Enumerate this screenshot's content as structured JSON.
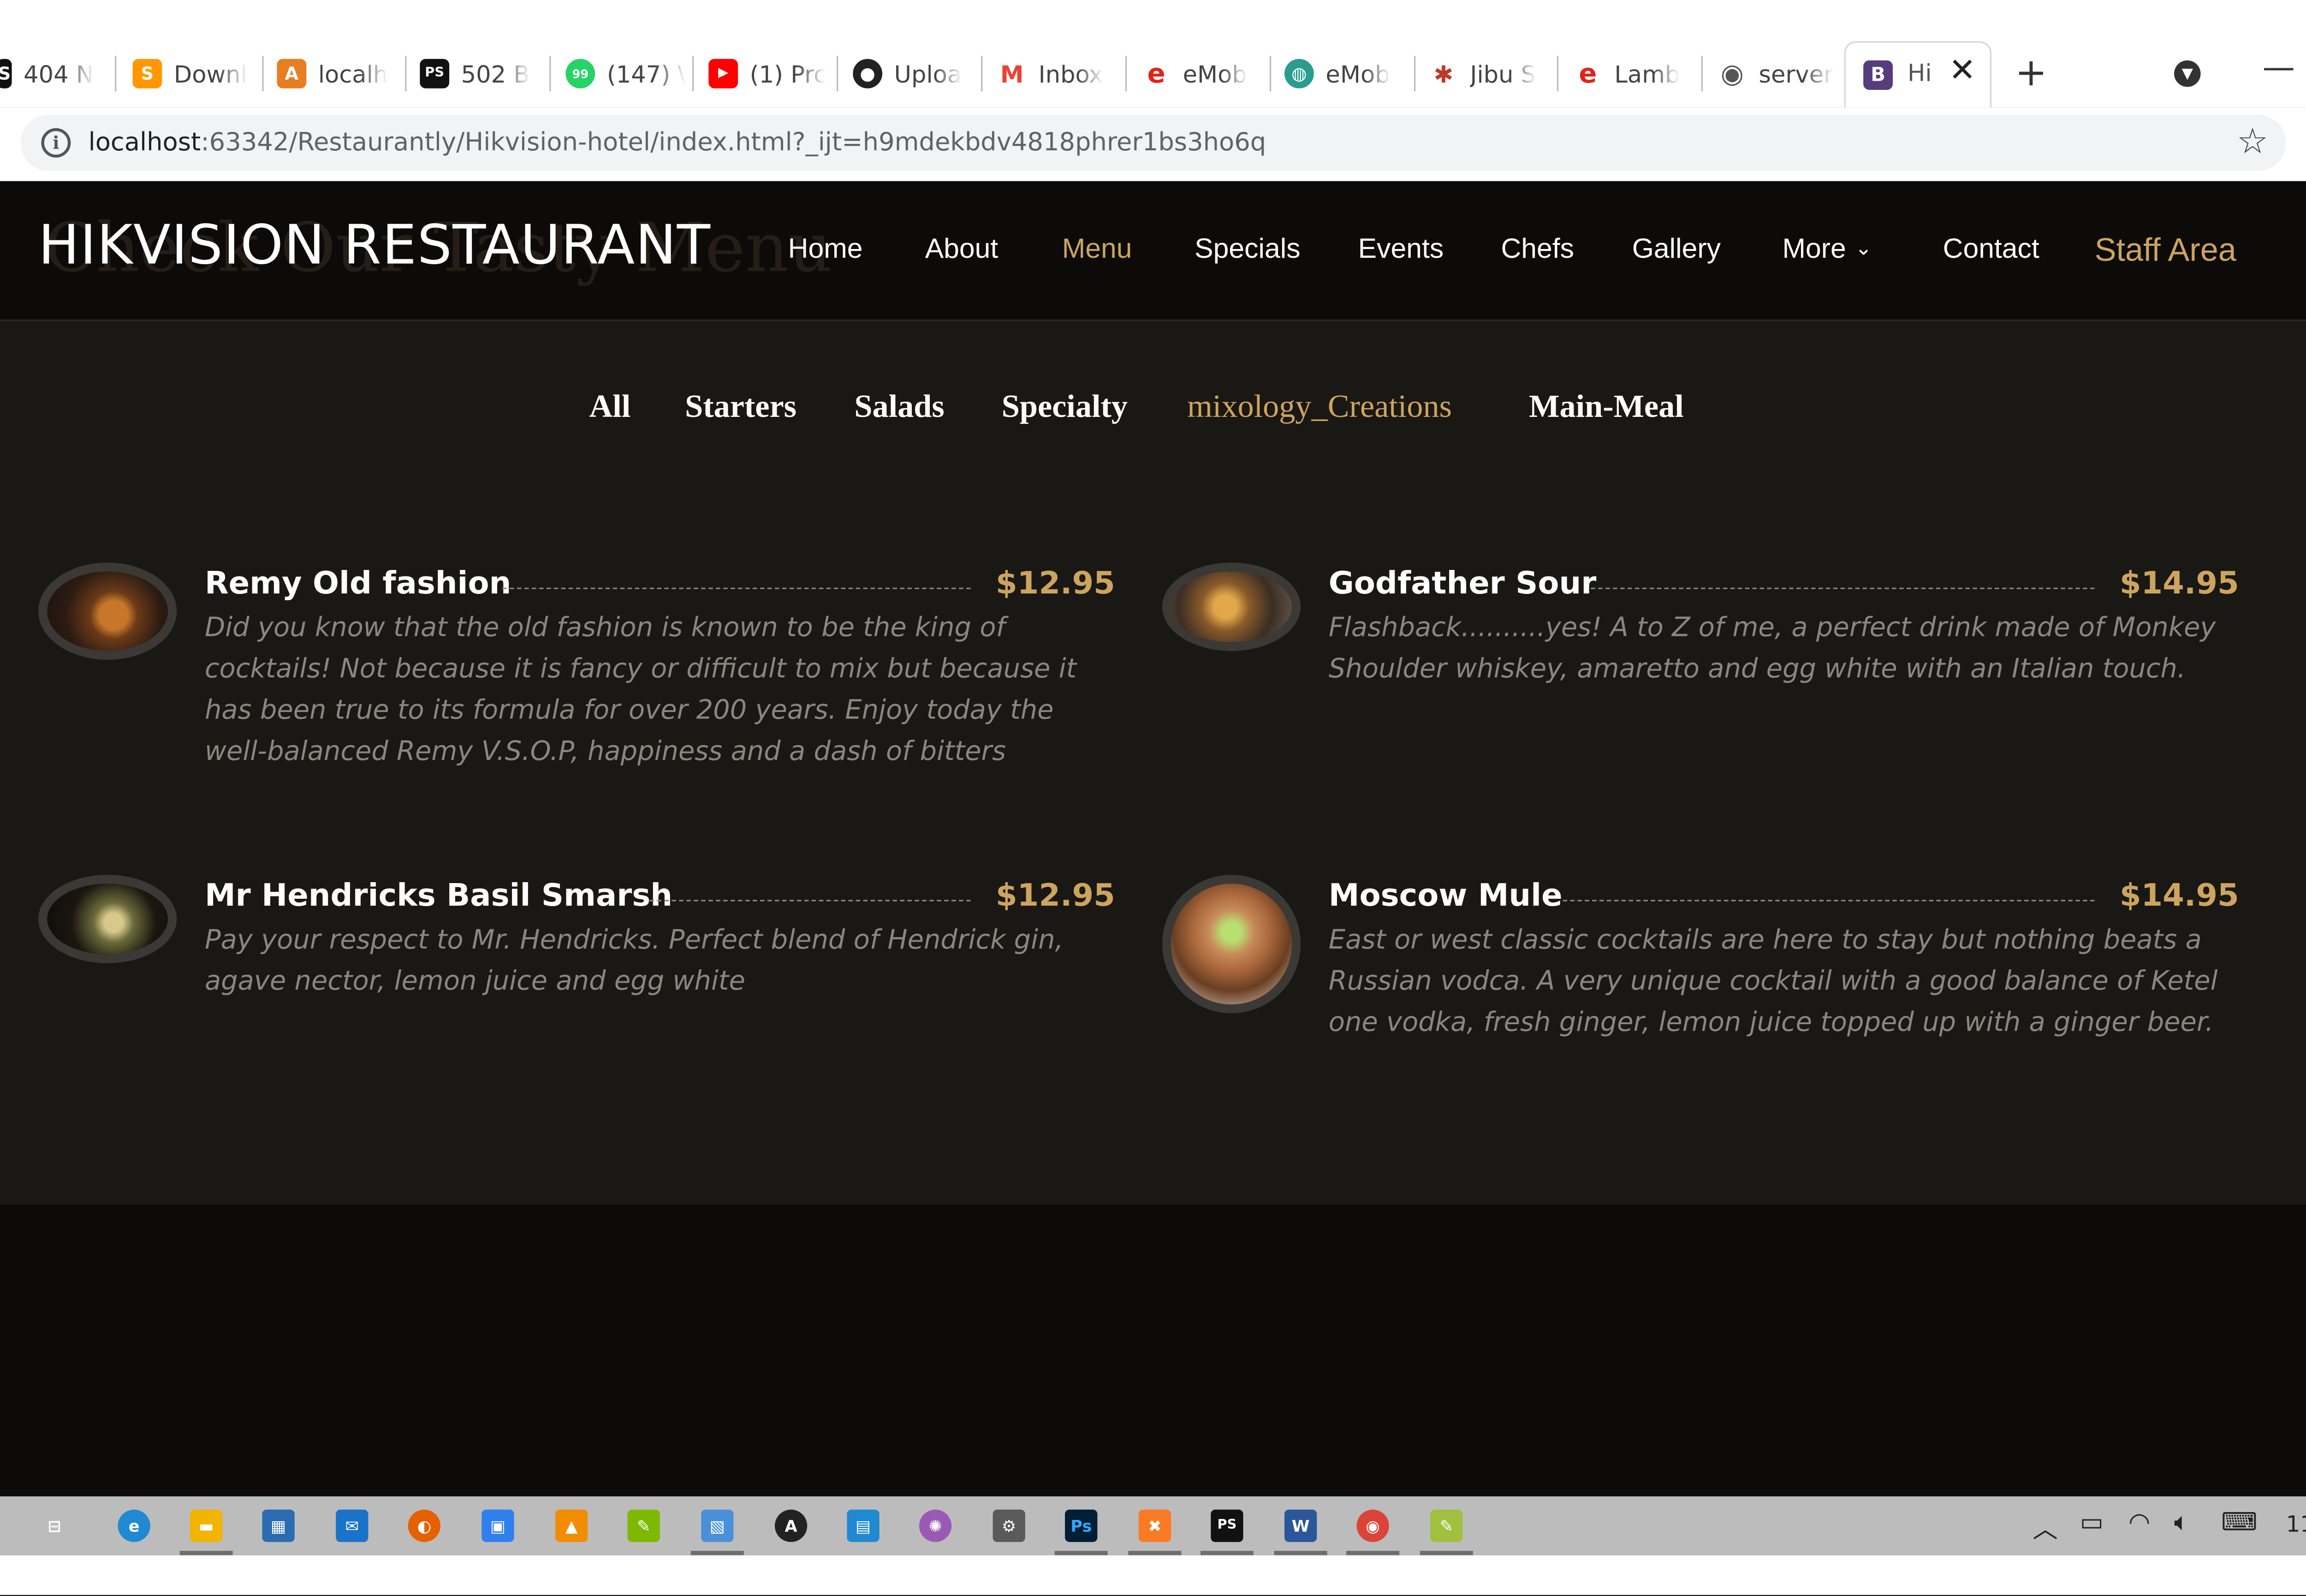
{
  "browser": {
    "tabs": [
      {
        "label": "404 N",
        "icon": "server-favicon-icon",
        "color": "#111111",
        "glyph": "S"
      },
      {
        "label": "Downl",
        "icon": "sublime-favicon-icon",
        "color": "#ff9800",
        "glyph": "S"
      },
      {
        "label": "localh",
        "icon": "phpmyadmin-favicon-icon",
        "color": "#e67e22",
        "glyph": "A"
      },
      {
        "label": "502 B",
        "icon": "phpstorm-favicon-icon",
        "color": "#111111",
        "glyph": "PS"
      },
      {
        "label": "(147) \\",
        "icon": "whatsapp-favicon-icon",
        "color": "#25d366",
        "glyph": "99"
      },
      {
        "label": "(1) Prc",
        "icon": "youtube-favicon-icon",
        "color": "#ff0000",
        "glyph": "▶"
      },
      {
        "label": "Uploa",
        "icon": "github-favicon-icon",
        "color": "#222222",
        "glyph": "●"
      },
      {
        "label": "Inbox",
        "icon": "gmail-favicon-icon",
        "color": "#ea4335",
        "glyph": "M"
      },
      {
        "label": "eMob",
        "icon": "emobilis-favicon-icon",
        "color": "#e2231a",
        "glyph": "e"
      },
      {
        "label": "eMob",
        "icon": "emobilis-globe-favicon-icon",
        "color": "#2a9d8f",
        "glyph": "◍"
      },
      {
        "label": "Jibu S",
        "icon": "jibu-favicon-icon",
        "color": "#c0392b",
        "glyph": "✱"
      },
      {
        "label": "Lamb",
        "icon": "lambda-favicon-icon",
        "color": "#e2231a",
        "glyph": "e"
      },
      {
        "label": "server",
        "icon": "globe-favicon-icon",
        "color": "#555555",
        "glyph": "◉"
      }
    ],
    "active_tab": {
      "label": "Hi",
      "glyph": "B"
    },
    "new_tab": "+",
    "url_host": "localhost",
    "url_rest": ":63342/Restaurantly/Hikvision-hotel/index.html?_ijt=h9mdekbdv4818phrer1bs3ho6q"
  },
  "site": {
    "brand": "HIKVISION RESTAURANT",
    "ghost_heading": "Check Our Tasty Menu",
    "nav": [
      "Home",
      "About",
      "Menu",
      "Specials",
      "Events",
      "Chefs",
      "Gallery",
      "More",
      "Contact"
    ],
    "staff_link": "Staff Area",
    "filters": [
      "All",
      "Starters",
      "Salads",
      "Specialty",
      "mixology_Creations",
      "Main-Meal"
    ],
    "active_filter": "mixology_Creations"
  },
  "menu_items": [
    {
      "title": "Remy Old fashion",
      "price": "$12.95",
      "desc": "Did you know that the old fashion is known to be the king of cocktails! Not because it is fancy or difficult to mix but because it has been true to its formula for over 200 years. Enjoy today the well-balanced Remy V.S.O.P, happiness and a dash of bitters"
    },
    {
      "title": "Godfather Sour",
      "price": "$14.95",
      "desc": "Flashback..........yes! A to Z of me, a perfect drink made of Monkey Shoulder whiskey, amaretto and egg white with an Italian touch."
    },
    {
      "title": "Mr Hendricks Basil Smarsh",
      "price": "$12.95",
      "desc": "Pay your respect to Mr. Hendricks. Perfect blend of Hendrick gin, agave nector, lemon juice and egg white"
    },
    {
      "title": "Moscow Mule",
      "price": "$14.95",
      "desc": "East or west classic cocktails are here to stay but nothing beats a Russian vodca. A very unique cocktail with a good balance of Ketel one vodka, fresh ginger, lemon juice topped up with a ginger beer."
    }
  ],
  "taskbar": {
    "apps": [
      {
        "icon": "task-view-icon",
        "color": "#5a5a5a",
        "glyph": "⊟"
      },
      {
        "icon": "edge-icon",
        "color": "#1f8ad2",
        "glyph": "e"
      },
      {
        "icon": "file-explorer-icon",
        "color": "#f2b400",
        "glyph": "▬"
      },
      {
        "icon": "store-icon",
        "color": "#2b6cb0",
        "glyph": "▦"
      },
      {
        "icon": "mail-icon",
        "color": "#1a73c8",
        "glyph": "✉"
      },
      {
        "icon": "firefox-icon",
        "color": "#e66000",
        "glyph": "◐"
      },
      {
        "icon": "control-panel-icon",
        "color": "#2f80ed",
        "glyph": "▣"
      },
      {
        "icon": "vlc-icon",
        "color": "#f28c00",
        "glyph": "▲"
      },
      {
        "icon": "notepad-plus-icon",
        "color": "#7fb800",
        "glyph": "✎"
      },
      {
        "icon": "photos-icon",
        "color": "#4a90d9",
        "glyph": "▧"
      },
      {
        "icon": "autodesk-icon",
        "color": "#222222",
        "glyph": "A"
      },
      {
        "icon": "remote-desktop-icon",
        "color": "#1f8ad2",
        "glyph": "▤"
      },
      {
        "icon": "pinwheel-icon",
        "color": "#9b59b6",
        "glyph": "✺"
      },
      {
        "icon": "settings-icon",
        "color": "#5a5a5a",
        "glyph": "⚙"
      },
      {
        "icon": "photoshop-icon",
        "color": "#001e36",
        "glyph": "Ps"
      },
      {
        "icon": "xampp-icon",
        "color": "#fb7a24",
        "glyph": "✖"
      },
      {
        "icon": "phpstorm-icon",
        "color": "#111111",
        "glyph": "PS"
      },
      {
        "icon": "word-icon",
        "color": "#2b579a",
        "glyph": "W"
      },
      {
        "icon": "chrome-icon",
        "color": "#db4437",
        "glyph": "◉"
      },
      {
        "icon": "notepad-icon",
        "color": "#a0c040",
        "glyph": "✎"
      }
    ],
    "clock": "11"
  },
  "colors": {
    "accent": "#cda45e",
    "section_bg": "#1a1814",
    "header_bg": "#0c0b0a",
    "muted_text": "#8a8680"
  }
}
